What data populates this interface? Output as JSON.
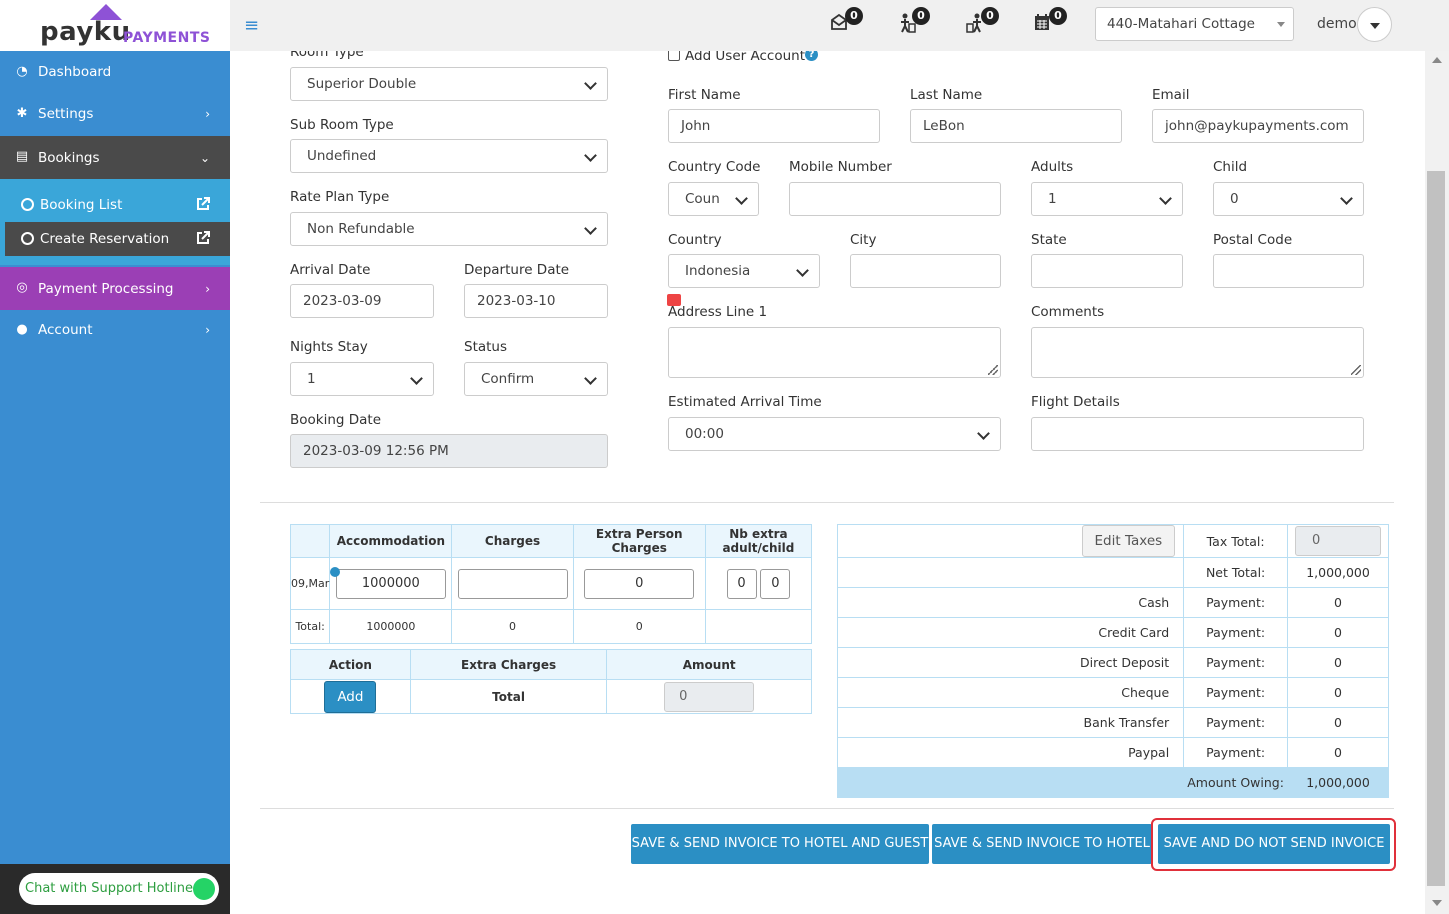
{
  "brand": {
    "name": "payku",
    "suffix": "PAYMENTS"
  },
  "sidebar": {
    "items": [
      {
        "label": "Dashboard",
        "icon": "dashboard-icon"
      },
      {
        "label": "Settings",
        "icon": "gear-icon"
      },
      {
        "label": "Bookings",
        "icon": "bookings-icon"
      },
      {
        "label": "Payment Processing",
        "icon": "payment-icon"
      },
      {
        "label": "Account",
        "icon": "user-icon"
      }
    ],
    "sub_items": [
      {
        "label": "Booking List"
      },
      {
        "label": "Create Reservation"
      }
    ],
    "chat_label": "Chat with Support Hotline"
  },
  "topbar": {
    "badges": [
      "0",
      "0",
      "0",
      "0"
    ],
    "hotel": "440-Matahari Cottage",
    "user": "demo"
  },
  "form": {
    "room_type_label": "Room Type",
    "room_type": "Superior Double",
    "sub_room_type_label": "Sub Room Type",
    "sub_room_type": "Undefined",
    "rate_plan_label": "Rate Plan Type",
    "rate_plan": "Non Refundable",
    "arrival_label": "Arrival Date",
    "arrival": "2023-03-09",
    "departure_label": "Departure Date",
    "departure": "2023-03-10",
    "nights_label": "Nights Stay",
    "nights": "1",
    "status_label": "Status",
    "status": "Confirm",
    "booking_date_label": "Booking Date",
    "booking_date": "2023-03-09 12:56 PM",
    "add_user_label": "Add User Account",
    "first_name_label": "First Name",
    "first_name": "John",
    "last_name_label": "Last Name",
    "last_name": "LeBon",
    "email_label": "Email",
    "email": "john@paykupayments.com",
    "country_code_label": "Country Code",
    "country_code": "Coun",
    "mobile_label": "Mobile Number",
    "adults_label": "Adults",
    "adults": "1",
    "child_label": "Child",
    "child": "0",
    "country_label": "Country",
    "country": "Indonesia",
    "city_label": "City",
    "state_label": "State",
    "postal_label": "Postal Code",
    "address_label": "Address Line 1",
    "comments_label": "Comments",
    "eta_label": "Estimated Arrival Time",
    "eta": "00:00",
    "flight_label": "Flight Details"
  },
  "charges_table": {
    "headers": [
      "Accommodation",
      "Charges",
      "Extra Person Charges",
      "Nb extra adult/child"
    ],
    "row": {
      "date": "09,Mar",
      "accommodation": "1000000",
      "charges": "",
      "extra": "0",
      "nb_adult": "0",
      "nb_child": "0"
    },
    "total": {
      "label": "Total:",
      "accommodation": "1000000",
      "charges": "0",
      "extra": "0"
    }
  },
  "extra_table": {
    "headers": [
      "Action",
      "Extra Charges",
      "Amount"
    ],
    "add_label": "Add",
    "total_label": "Total",
    "amount": "0"
  },
  "payments": {
    "edit_taxes": "Edit Taxes",
    "tax_total_label": "Tax Total:",
    "tax_total": "0",
    "net_total_label": "Net Total:",
    "net_total": "1,000,000",
    "rows": [
      {
        "method": "Cash",
        "label": "Payment:",
        "value": "0"
      },
      {
        "method": "Credit Card",
        "label": "Payment:",
        "value": "0"
      },
      {
        "method": "Direct Deposit",
        "label": "Payment:",
        "value": "0"
      },
      {
        "method": "Cheque",
        "label": "Payment:",
        "value": "0"
      },
      {
        "method": "Bank Transfer",
        "label": "Payment:",
        "value": "0"
      },
      {
        "method": "Paypal",
        "label": "Payment:",
        "value": "0"
      }
    ],
    "owing_label": "Amount Owing:",
    "owing": "1,000,000"
  },
  "actions": {
    "send_hotel_guest": "SAVE & SEND INVOICE TO HOTEL AND GUEST",
    "send_hotel": "SAVE & SEND INVOICE TO HOTEL",
    "no_send": "SAVE AND DO NOT SEND INVOICE"
  },
  "colors": {
    "sidebar": "#3a8dd1",
    "bookings_active": "#4a4a4a",
    "payment": "#9b3fb5",
    "primary_button": "#2b8fc4",
    "highlight": "#e0303a",
    "brand_purple": "#8e52d6"
  }
}
